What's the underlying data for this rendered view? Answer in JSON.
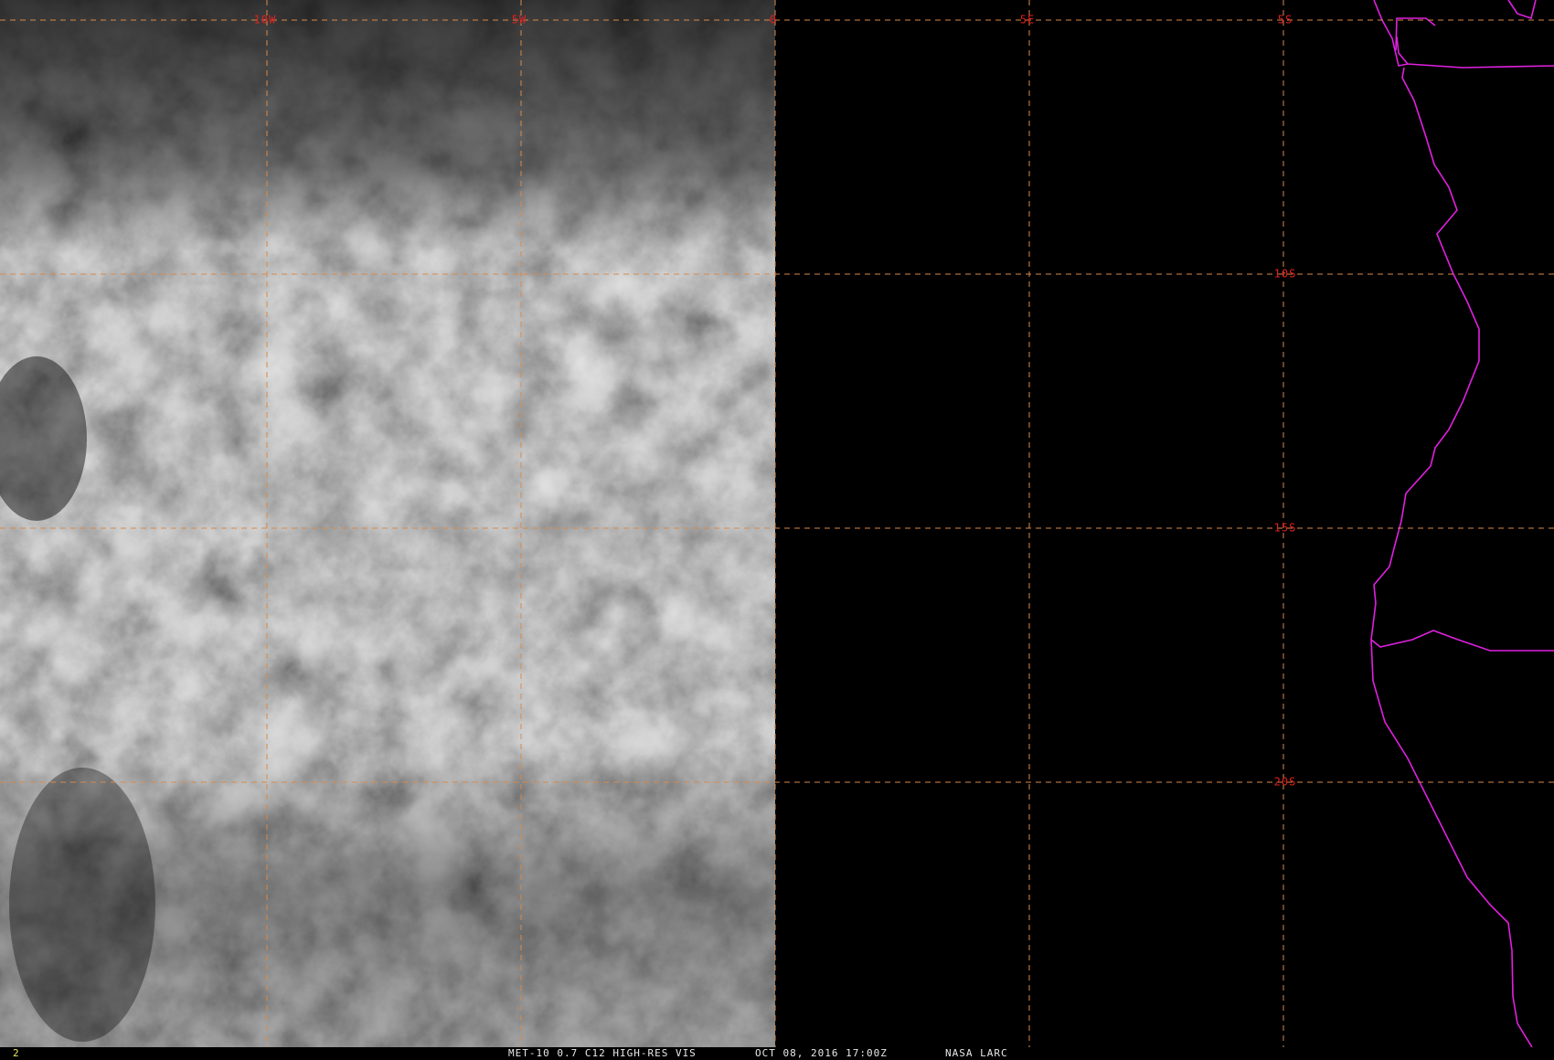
{
  "image": {
    "satellite_caption": "MET-10 0.7 C12 HIGH-RES VIS",
    "timestamp": "OCT 08, 2016 17:00Z",
    "credit": "NASA LARC",
    "frame_number": "2"
  },
  "grid": {
    "longitudes": [
      {
        "label": "10W",
        "value": -10
      },
      {
        "label": "5W",
        "value": -5
      },
      {
        "label": "0",
        "value": 0
      },
      {
        "label": "5E",
        "value": 5
      }
    ],
    "latitudes": [
      {
        "label": "5S",
        "value": -5
      },
      {
        "label": "10S",
        "value": -10
      },
      {
        "label": "15S",
        "value": -15
      },
      {
        "label": "20S",
        "value": -20
      }
    ],
    "line_color": "#d88a4a",
    "label_color": "#e02020"
  },
  "coastline_color": "#e020e0",
  "night_region": "east of 0"
}
